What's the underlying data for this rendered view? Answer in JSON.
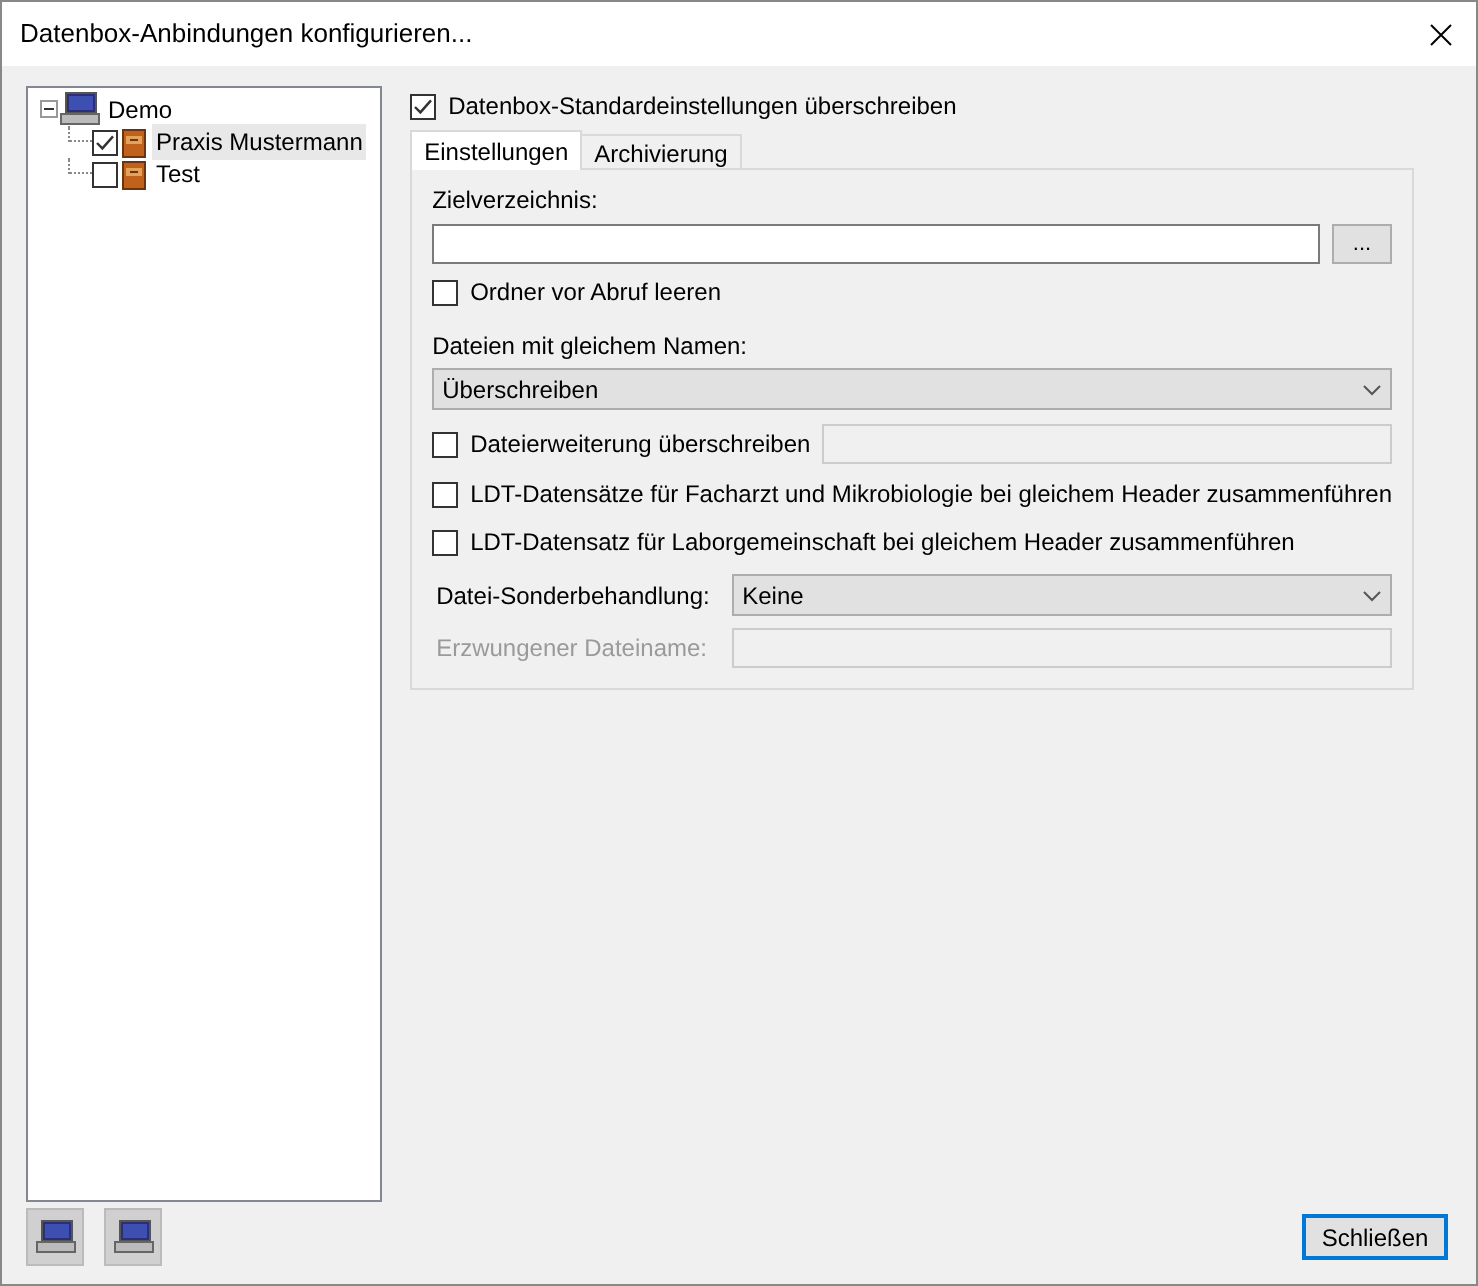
{
  "window": {
    "title": "Datenbox-Anbindungen konfigurieren..."
  },
  "tree": {
    "label": "Demo",
    "expanded": true,
    "children": [
      {
        "label": "Praxis Mustermann",
        "checked": true,
        "selected": true
      },
      {
        "label": "Test",
        "checked": false,
        "selected": false
      }
    ]
  },
  "override": {
    "label": "Datenbox-Standardeinstellungen überschreiben",
    "checked": true
  },
  "tabs": [
    {
      "label": "Einstellungen",
      "selected": true
    },
    {
      "label": "Archivierung",
      "selected": false
    }
  ],
  "settings": {
    "target_dir_label": "Zielverzeichnis:",
    "browse_button": "...",
    "options": [
      {
        "kind": "checkbox",
        "label": "Ordner vor Abruf leeren",
        "checked": false
      },
      {
        "kind": "select",
        "label": "Dateien mit gleichem Namen:",
        "value": "Überschreiben"
      },
      {
        "kind": "checkbox-field",
        "label": "Dateierweiterung überschreiben",
        "checked": false
      },
      {
        "kind": "checkbox",
        "label": "LDT-Datensätze für Facharzt und Mikrobiologie bei gleichem Header zusammenführen",
        "checked": false
      },
      {
        "kind": "checkbox",
        "label": "LDT-Datensatz für Laborgemeinschaft bei gleichem Header zusammenführen",
        "checked": false
      },
      {
        "kind": "inline-select",
        "label": "Datei-Sonderbehandlung:",
        "value": "Keine"
      },
      {
        "kind": "inline-field",
        "label": "Erzwungener Dateiname:",
        "disabled": true
      }
    ]
  },
  "close_button": "Schließen"
}
